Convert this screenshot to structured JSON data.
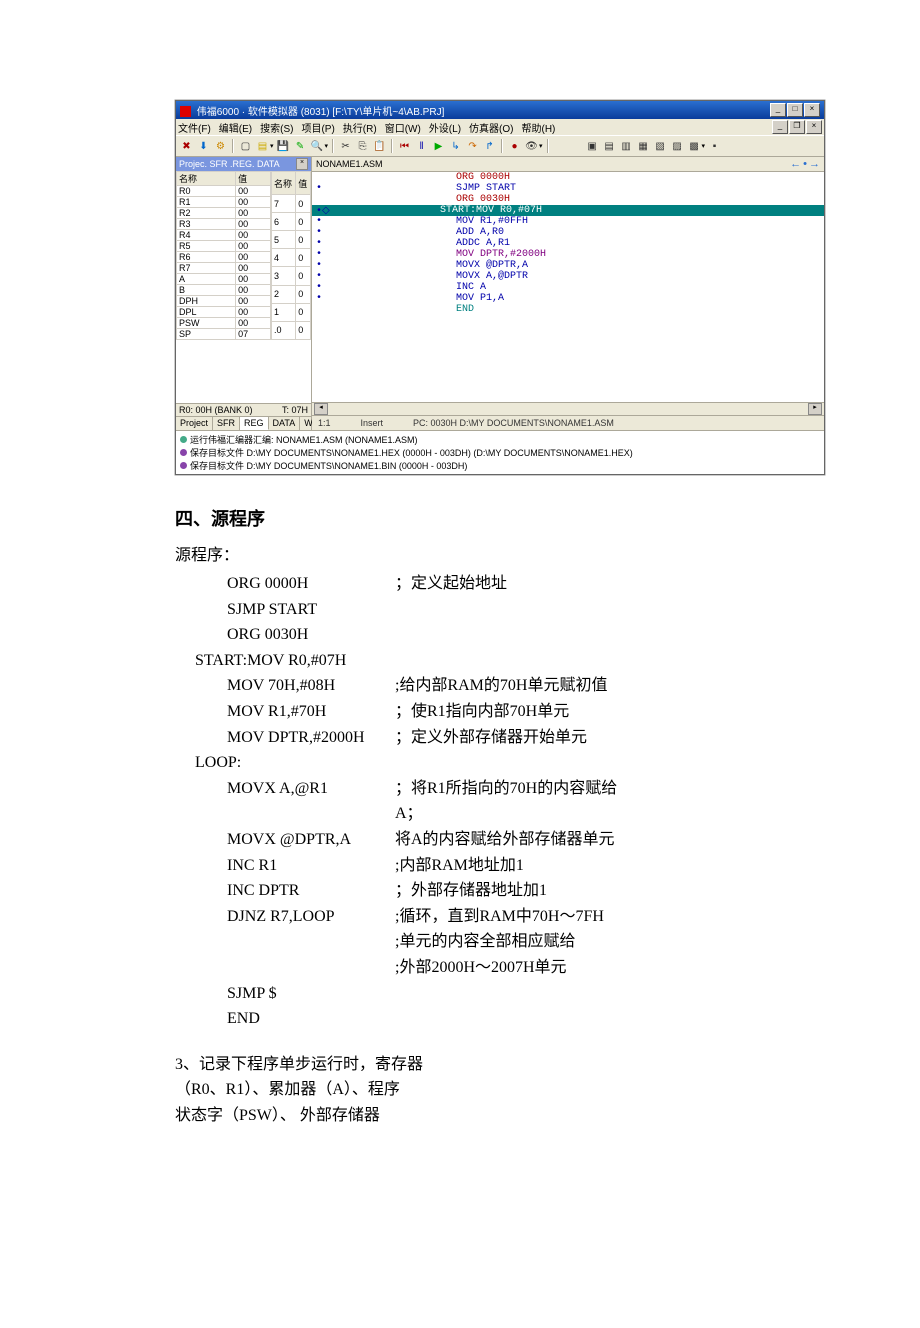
{
  "ide": {
    "title": "伟福6000 · 软件模拟器 (8031) [F:\\TY\\单片机~4\\AB.PRJ]",
    "menus": [
      "文件(F)",
      "编辑(E)",
      "搜索(S)",
      "项目(P)",
      "执行(R)",
      "窗口(W)",
      "外设(L)",
      "仿真器(O)",
      "帮助(H)"
    ],
    "panel_title": "Projec. SFR .REG. DATA",
    "doc_tab": "NONAME1.ASM",
    "regs_left_header": [
      "名称",
      "值"
    ],
    "regs_left": [
      {
        "n": "R0",
        "v": "00"
      },
      {
        "n": "R1",
        "v": "00"
      },
      {
        "n": "R2",
        "v": "00"
      },
      {
        "n": "R3",
        "v": "00"
      },
      {
        "n": "R4",
        "v": "00"
      },
      {
        "n": "R5",
        "v": "00"
      },
      {
        "n": "R6",
        "v": "00"
      },
      {
        "n": "R7",
        "v": "00"
      },
      {
        "n": "A",
        "v": "00"
      },
      {
        "n": "B",
        "v": "00"
      },
      {
        "n": "DPH",
        "v": "00"
      },
      {
        "n": "DPL",
        "v": "00"
      },
      {
        "n": "PSW",
        "v": "00"
      },
      {
        "n": "SP",
        "v": "07"
      }
    ],
    "regs_right_header": [
      "名称",
      "值"
    ],
    "regs_right": [
      {
        "n": "7",
        "v": "0"
      },
      {
        "n": "6",
        "v": "0"
      },
      {
        "n": "5",
        "v": "0"
      },
      {
        "n": "4",
        "v": "0"
      },
      {
        "n": "3",
        "v": "0"
      },
      {
        "n": "2",
        "v": "0"
      },
      {
        "n": "1",
        "v": "0"
      },
      {
        "n": ".0",
        "v": "0"
      }
    ],
    "left_bottom_left": "R0: 00H (BANK 0)",
    "left_bottom_right": "T: 07H",
    "left_tabs": [
      "Project",
      "SFR",
      "REG",
      "DATA",
      "Watch"
    ],
    "left_tab_active": 2,
    "code": [
      {
        "g": "",
        "t": "ORG 0000H",
        "cls": "c-red"
      },
      {
        "g": "•",
        "t": "SJMP START",
        "cls": "c-blue"
      },
      {
        "g": "",
        "t": "ORG 0030H",
        "cls": "c-red"
      },
      {
        "g": "•◇",
        "t": "START:MOV R0,#07H",
        "cls": "hl"
      },
      {
        "g": "•",
        "t": "MOV R1,#0FFH",
        "cls": "c-blue"
      },
      {
        "g": "•",
        "t": "ADD A,R0",
        "cls": "c-blue"
      },
      {
        "g": "•",
        "t": "ADDC A,R1",
        "cls": "c-blue"
      },
      {
        "g": "•",
        "t": "MOV DPTR,#2000H",
        "cls": "c-purple"
      },
      {
        "g": "•",
        "t": "MOVX @DPTR,A",
        "cls": "c-blue"
      },
      {
        "g": "•",
        "t": "MOVX A,@DPTR",
        "cls": "c-blue"
      },
      {
        "g": "•",
        "t": "INC A",
        "cls": "c-blue"
      },
      {
        "g": "•",
        "t": "MOV P1,A",
        "cls": "c-blue"
      },
      {
        "g": "",
        "t": "END",
        "cls": "c-teal"
      }
    ],
    "status_pos": "1:1",
    "status_mode": "Insert",
    "status_pc": "PC: 0030H  D:\\MY DOCUMENTS\\NONAME1.ASM",
    "output": [
      {
        "b": "g",
        "t": "运行伟福汇编器汇编:  NONAME1.ASM  (NONAME1.ASM)"
      },
      {
        "b": "p",
        "t": "保存目标文件 D:\\MY DOCUMENTS\\NONAME1.HEX  (0000H - 003DH)  (D:\\MY DOCUMENTS\\NONAME1.HEX)"
      },
      {
        "b": "p",
        "t": "保存目标文件 D:\\MY DOCUMENTS\\NONAME1.BIN  (0000H - 003DH)"
      }
    ]
  },
  "doc": {
    "heading": "四、源程序",
    "intro": "源程序：",
    "code_lines": [
      {
        "c": "        ORG 0000H",
        "m": "；定义起始地址"
      },
      {
        "c": "        SJMP START",
        "m": ""
      },
      {
        "c": "        ORG 0030H",
        "m": ""
      },
      {
        "c": "START:MOV R0,#07H",
        "m": ""
      },
      {
        "c": "        MOV 70H,#08H",
        "m": ";给内部RAM的70H单元赋初值"
      },
      {
        "c": "        MOV R1,#70H",
        "m": "；使R1指向内部70H单元"
      },
      {
        "c": "        MOV DPTR,#2000H",
        "m": "；定义外部存储器开始单元"
      },
      {
        "c": "LOOP:",
        "m": ""
      },
      {
        "c": "        MOVX A,@R1",
        "m": "；将R1所指向的70H的内容赋给A；"
      },
      {
        "c": "        MOVX @DPTR,A",
        "m": "将A的内容赋给外部存储器单元"
      },
      {
        "c": "        INC R1",
        "m": ";内部RAM地址加1"
      },
      {
        "c": "        INC DPTR",
        "m": "；外部存储器地址加1"
      },
      {
        "c": "        DJNZ R7,LOOP",
        "m": ";循环，直到RAM中70H～7FH"
      },
      {
        "c": "",
        "m": ";单元的内容全部相应赋给"
      },
      {
        "c": "",
        "m": ";外部2000H～2007H单元"
      },
      {
        "c": "",
        "m": ""
      },
      {
        "c": "        SJMP $",
        "m": ""
      },
      {
        "c": "        END",
        "m": ""
      }
    ],
    "para1": "3、记录下程序单步运行时，寄存器",
    "para2": "（R0、R1）、累加器（A）、程序",
    "para3": "状态字（PSW）、 外部存储器"
  }
}
